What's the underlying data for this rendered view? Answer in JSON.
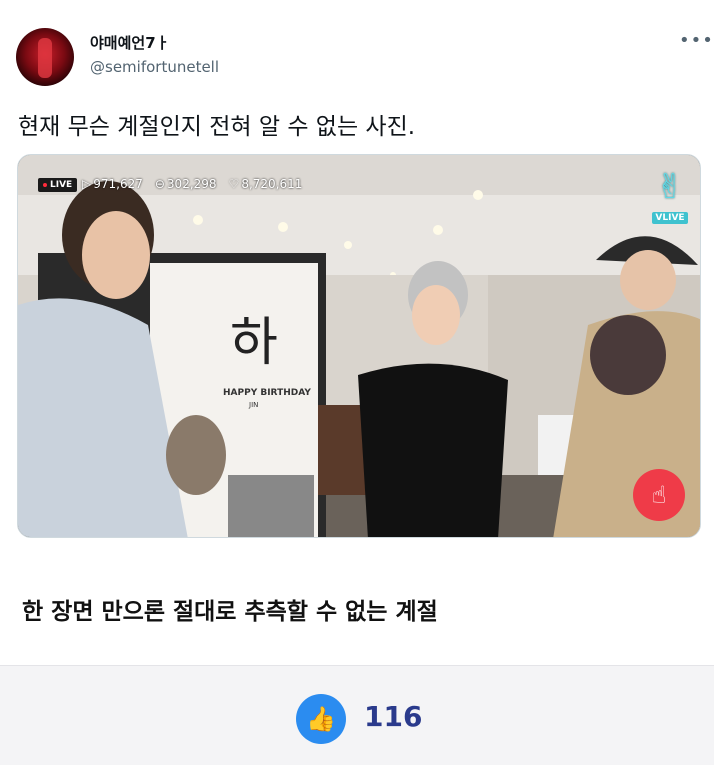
{
  "tweet": {
    "display_name": "야매예언7ㅏ",
    "handle": "@semifortunetell",
    "more_icon": "more-horizontal-icon",
    "text": "현재 무슨 계절인지 전혀 알 수 없는 사진."
  },
  "media": {
    "live_badge": "LIVE",
    "stats": {
      "views": "971,627",
      "comments": "302,298",
      "hearts": "8,720,611"
    },
    "vlive_label": "VLIVE",
    "banner": {
      "char": "하",
      "line1": "HAPPY BIRTHDAY",
      "line2": "JIN"
    }
  },
  "caption": "한 장면 만으론 절대로 추측할 수 없는 계절",
  "reactions": {
    "icon": "thumbs-up-icon",
    "count": "116",
    "accent": "#2b8cf0"
  }
}
